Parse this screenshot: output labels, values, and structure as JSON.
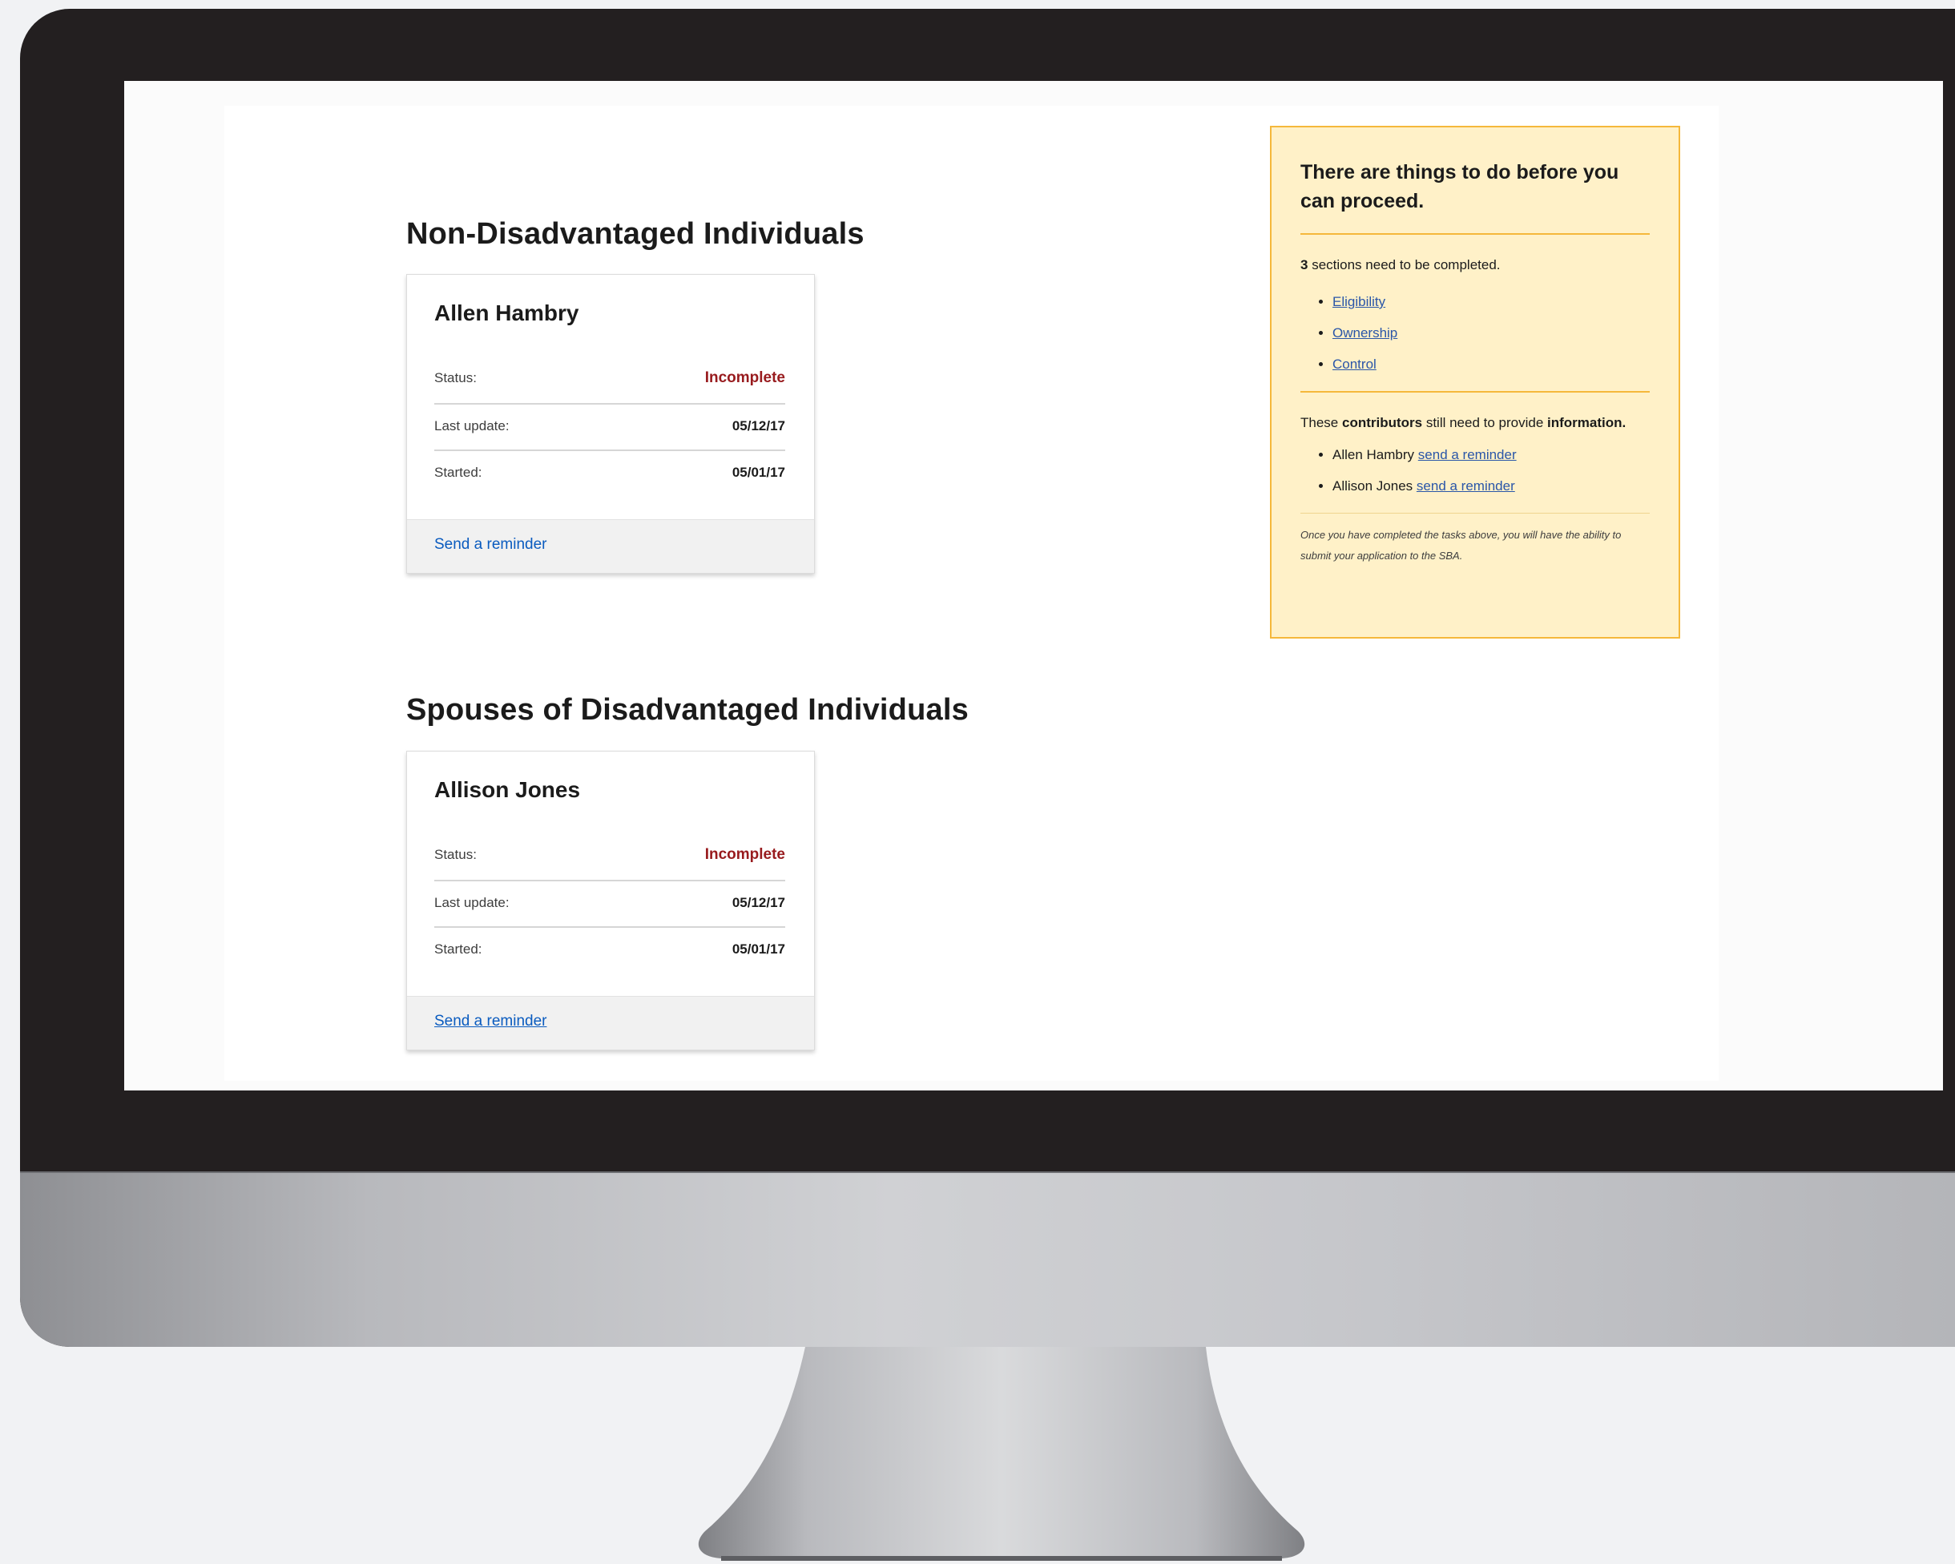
{
  "sections": [
    {
      "title": "Non-Disadvantaged Individuals",
      "card": {
        "name": "Allen Hambry",
        "status_label": "Status:",
        "status_value": "Incomplete",
        "last_update_label": "Last update:",
        "last_update_value": "05/12/17",
        "started_label": "Started:",
        "started_value": "05/01/17",
        "reminder_link": "Send a reminder"
      }
    },
    {
      "title": "Spouses of Disadvantaged Individuals",
      "card": {
        "name": "Allison Jones",
        "status_label": "Status:",
        "status_value": "Incomplete",
        "last_update_label": "Last update:",
        "last_update_value": "05/12/17",
        "started_label": "Started:",
        "started_value": "05/01/17",
        "reminder_link": "Send a reminder"
      }
    }
  ],
  "alert": {
    "title": "There are things to do before you can proceed.",
    "sections_count": "3",
    "sections_text": " sections need to be completed.",
    "section_links": [
      "Eligibility",
      "Ownership",
      "Control"
    ],
    "contributors_prefix": "These ",
    "contributors_bold": "contributors",
    "contributors_suffix": " still need to provide ",
    "contributors_bold2": "information.",
    "contributors": [
      {
        "name": "Allen Hambry",
        "link": "send a reminder"
      },
      {
        "name": "Allison Jones",
        "link": "send a reminder"
      }
    ],
    "note": "Once you have completed the tasks above, you will have the ability to submit your application to the SBA."
  },
  "colors": {
    "status_incomplete": "#981b1e",
    "link": "#0a5bbf",
    "alert_bg": "#fff1c8",
    "alert_border": "#f5b83b",
    "bezel": "#231f20"
  }
}
